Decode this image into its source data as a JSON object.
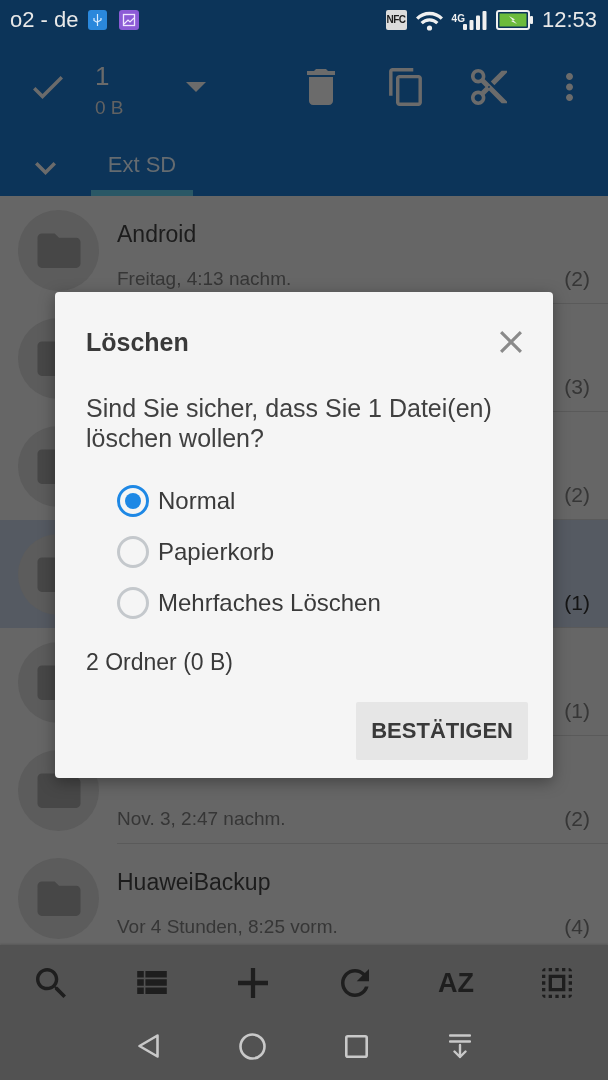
{
  "status_bar": {
    "carrier": "o2 - de",
    "nfc": "NFC",
    "network": "4G",
    "time": "12:53"
  },
  "selection_bar": {
    "count": "1",
    "size": "0 B"
  },
  "tabs": [
    {
      "label": "Ext SD",
      "selected": true
    }
  ],
  "files": [
    {
      "name": "Android",
      "date": "Freitag, 4:13 nachm.",
      "count": "(2)",
      "selected": false
    },
    {
      "count": "(3)",
      "selected": false
    },
    {
      "count": "(2)",
      "selected": false
    },
    {
      "count": "(1)",
      "selected": true
    },
    {
      "count": "(1)",
      "selected": false
    },
    {
      "date": "Nov. 3, 2:47 nachm.",
      "count": "(2)",
      "selected": false
    },
    {
      "name": "HuaweiBackup",
      "date": "Vor 4 Stunden, 8:25 vorm.",
      "count": "(4)",
      "selected": false
    }
  ],
  "dialog": {
    "title": "Löschen",
    "message": "Sind Sie sicher, dass Sie 1 Datei(en) löschen wollen?",
    "options": [
      {
        "label": "Normal",
        "selected": true
      },
      {
        "label": "Papierkorb",
        "selected": false
      },
      {
        "label": "Mehrfaches Löschen",
        "selected": false
      }
    ],
    "summary": "2 Ordner (0 B)",
    "button": "BESTÄTIGEN"
  },
  "bottom_bar": {
    "sort": "AZ"
  }
}
